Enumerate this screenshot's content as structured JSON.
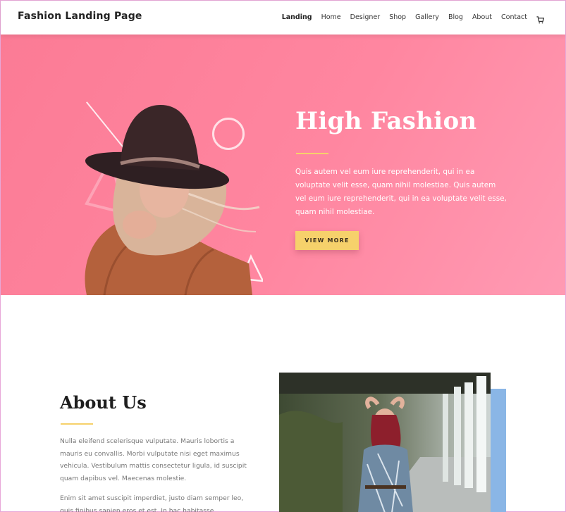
{
  "header": {
    "brand": "Fashion Landing Page",
    "nav": [
      "Landing",
      "Home",
      "Designer",
      "Shop",
      "Gallery",
      "Blog",
      "About",
      "Contact"
    ],
    "cart_icon": "shopping-cart-icon"
  },
  "hero": {
    "title": "High Fashion",
    "text": "Quis autem vel eum iure reprehenderit, qui in ea voluptate velit esse, quam nihil molestiae. Quis autem vel eum iure reprehenderit, qui in ea voluptate velit esse, quam nihil molestiae.",
    "button_label": "VIEW MORE",
    "colors": {
      "background": "#fb7b95",
      "accent": "#f6d16b"
    }
  },
  "about": {
    "title": "About Us",
    "p1": "Nulla eleifend scelerisque vulputate. Mauris lobortis a mauris eu convallis. Morbi vulputate nisi eget maximus vehicula. Vestibulum mattis consectetur ligula, id suscipit quam dapibus vel. Maecenas molestie.",
    "p2": "Enim sit amet suscipit imperdiet, justo diam semper leo, quis finibus sapien eros et est. In hac habitasse",
    "accent_color": "#8ab6e6"
  }
}
